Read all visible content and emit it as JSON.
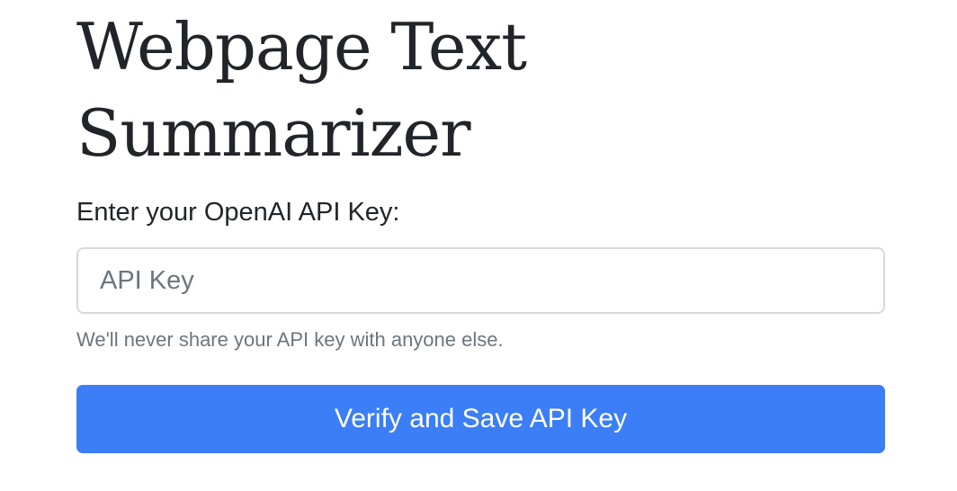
{
  "page": {
    "title": "Webpage Text Summarizer"
  },
  "form": {
    "api_key_label": "Enter your OpenAI API Key:",
    "api_key_placeholder": "API Key",
    "api_key_value": "",
    "help_text": "We'll never share your API key with anyone else.",
    "submit_label": "Verify and Save API Key"
  },
  "colors": {
    "primary_button": "#3b7ef7",
    "muted_text": "#6c757d",
    "body_text": "#212529",
    "input_border": "#d6d8db"
  }
}
